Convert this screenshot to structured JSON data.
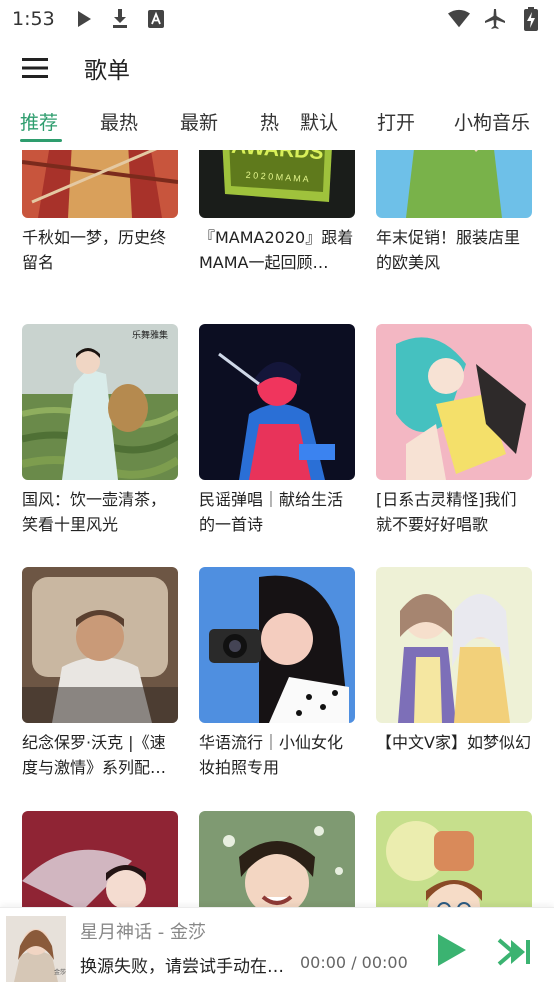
{
  "status_bar": {
    "time": "1:53",
    "left_icons": [
      "play-icon",
      "download-icon",
      "accessibility-a-icon"
    ],
    "right_icons": [
      "wifi-icon",
      "airplane-icon",
      "battery-charging-icon"
    ]
  },
  "app_bar": {
    "menu_icon": "hamburger-menu-icon",
    "title": "歌单"
  },
  "tabs": [
    {
      "label": "推荐",
      "active": true
    },
    {
      "label": "最热",
      "active": false
    },
    {
      "label": "最新",
      "active": false
    },
    {
      "label": "热",
      "active": false
    },
    {
      "label": "默认",
      "active": false
    },
    {
      "label": "打开",
      "active": false
    },
    {
      "label": "小枸音乐",
      "active": false
    }
  ],
  "playlists": [
    {
      "title": "千秋如一梦，历史终留名"
    },
    {
      "title": "『MAMA2020』跟着MAMA一起回顾…",
      "cover_text": "AWARDS 2020 MAMA"
    },
    {
      "title": "年末促销！服装店里的欧美风"
    },
    {
      "title": "国风：饮一壶清茶，笑看十里风光",
      "cover_text": "乐舞雅集"
    },
    {
      "title": "民谣弹唱｜献给生活的一首诗"
    },
    {
      "title": "[日系古灵精怪]我们就不要好好唱歌"
    },
    {
      "title": "纪念保罗·沃克 |《速度与激情》系列配…"
    },
    {
      "title": "华语流行｜小仙女化妆拍照专用"
    },
    {
      "title": "【中文V家】如梦似幻"
    },
    {
      "title": ""
    },
    {
      "title": ""
    },
    {
      "title": ""
    }
  ],
  "player": {
    "song": "星月神话 - 金莎",
    "status": "换源失败，请尝试手动在搜…",
    "time": "00:00 / 00:00",
    "accent_color": "#3bb371"
  },
  "colors": {
    "accent": "#2e9d6e",
    "player_button": "#3bb371"
  }
}
